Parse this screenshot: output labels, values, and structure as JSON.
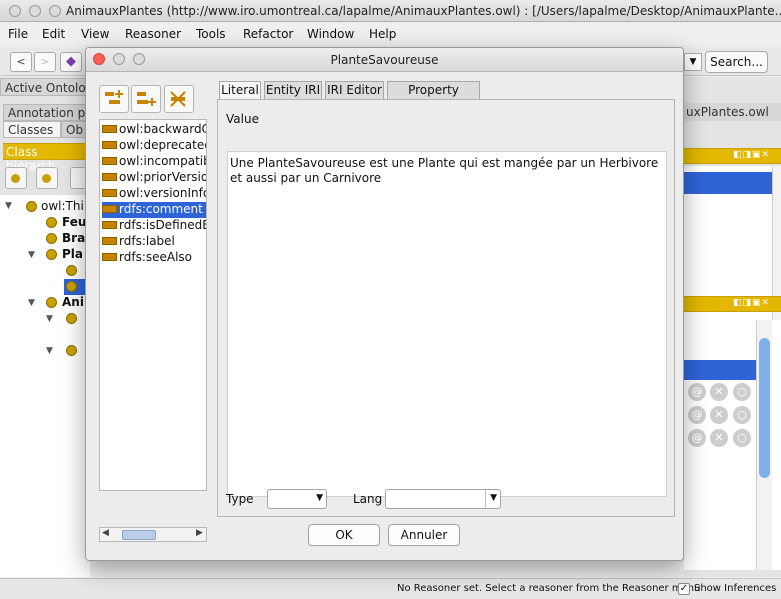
{
  "window": {
    "title": "AnimauxPlantes (http://www.iro.umontreal.ca/lapalme/AnimauxPlantes.owl)  : [/Users/lapalme/Desktop/AnimauxPlante..."
  },
  "menubar": {
    "items": [
      "File",
      "Edit",
      "View",
      "Reasoner",
      "Tools",
      "Refactor",
      "Window",
      "Help"
    ]
  },
  "toolbar": {
    "back_label": "<",
    "forward_label": ">",
    "search_label": "Search..."
  },
  "background": {
    "active_ontology_tab": "Active Ontolog",
    "annotation_tab": "Annotation pro",
    "classes_tab": "Classes",
    "object_tab": "Ob",
    "class_hierarchy_label": "Class hierarch",
    "ontology_file_label": "uxPlantes.owl",
    "tree": [
      {
        "label": "owl:Thi",
        "bold": false
      },
      {
        "label": "Feu",
        "bold": true
      },
      {
        "label": "Bra",
        "bold": true
      },
      {
        "label": "Pla",
        "bold": true
      },
      {
        "label": "Ani",
        "bold": true
      }
    ],
    "reasoner_status": "No Reasoner set. Select a reasoner from the Reasoner menu",
    "show_inferences_label": "Show Inferences",
    "show_inferences_checked": true
  },
  "dialog": {
    "title": "PlanteSavoureuse",
    "properties": [
      "owl:backwardC",
      "owl:deprecatec",
      "owl:incompatib",
      "owl:priorVersio",
      "owl:versionInfo",
      "rdfs:comment",
      "rdfs:isDefinedB",
      "rdfs:label",
      "rdfs:seeAlso"
    ],
    "selected_property": "rdfs:comment",
    "tabs": [
      "Literal",
      "Entity IRI",
      "IRI Editor",
      "Property values"
    ],
    "active_tab": "Literal",
    "value_label": "Value",
    "value_text": "Une PlanteSavoureuse est une Plante qui est mangée par un Herbivore et aussi par un Carnivore",
    "type_label": "Type",
    "type_value": "",
    "lang_label": "Lang",
    "lang_value": "",
    "ok_label": "OK",
    "cancel_label": "Annuler"
  },
  "colors": {
    "selection": "#2f64d6",
    "accent_gold": "#e4b800",
    "property_icon": "#c88400"
  }
}
